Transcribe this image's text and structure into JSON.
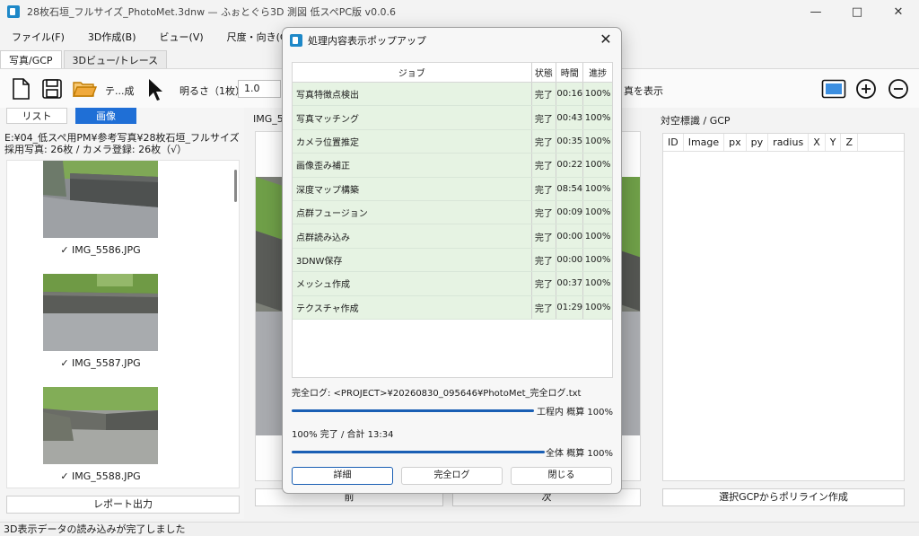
{
  "window": {
    "title": "28枚石垣_フルサイズ_PhotoMet.3dnw — ふぉとぐら3D 測図 低スペPC版 v0.0.6",
    "minimize": "—",
    "maximize": "□",
    "close": "✕"
  },
  "menu": [
    "ファイル(F)",
    "3D作成(B)",
    "ビュー(V)",
    "尺度・向き(C)"
  ],
  "tabs": [
    "写真/GCP",
    "3Dビュー/トレース"
  ],
  "toolbar": {
    "texture_label": "テ...成",
    "brightness_label": "明るさ（1枚）",
    "brightness_value": "1.0",
    "show_label": "真を表示"
  },
  "left": {
    "list_button": "リスト",
    "image_button": "画像",
    "path": "E:¥04_低スペ用PM¥参考写真¥28枚石垣_フルサイズ",
    "counts": "採用写真: 26枚 / カメラ登録: 26枚（√）",
    "thumbnails": [
      {
        "caption": "✓ IMG_5586.JPG"
      },
      {
        "caption": "✓ IMG_5587.JPG"
      },
      {
        "caption": "✓ IMG_5588.JPG"
      }
    ],
    "report_button": "レポート出力"
  },
  "center": {
    "image_label": "IMG_55",
    "prev_button": "前",
    "next_button": "次"
  },
  "right": {
    "title": "対空標識 / GCP",
    "columns": [
      "ID",
      "Image",
      "px",
      "py",
      "radius",
      "X",
      "Y",
      "Z"
    ],
    "polyline_button": "選択GCPからポリライン作成"
  },
  "status": "3D表示データの読み込みが完了しました",
  "dialog": {
    "title": "処理内容表示ポップアップ",
    "close": "✕",
    "headers": {
      "job": "ジョブ",
      "status": "状態",
      "time": "時間",
      "progress": "進捗"
    },
    "jobs": [
      {
        "name": "写真特徴点検出",
        "status": "完了",
        "time": "00:16",
        "progress": "100%"
      },
      {
        "name": "写真マッチング",
        "status": "完了",
        "time": "00:43",
        "progress": "100%"
      },
      {
        "name": "カメラ位置推定",
        "status": "完了",
        "time": "00:35",
        "progress": "100%"
      },
      {
        "name": "画像歪み補正",
        "status": "完了",
        "time": "00:22",
        "progress": "100%"
      },
      {
        "name": "深度マップ構築",
        "status": "完了",
        "time": "08:54",
        "progress": "100%"
      },
      {
        "name": "点群フュージョン",
        "status": "完了",
        "time": "00:09",
        "progress": "100%"
      },
      {
        "name": "点群読み込み",
        "status": "完了",
        "time": "00:00",
        "progress": "100%"
      },
      {
        "name": "3DNW保存",
        "status": "完了",
        "time": "00:00",
        "progress": "100%"
      },
      {
        "name": "メッシュ作成",
        "status": "完了",
        "time": "00:37",
        "progress": "100%"
      },
      {
        "name": "テクスチャ作成",
        "status": "完了",
        "time": "01:29",
        "progress": "100%"
      }
    ],
    "log": "完全ログ: <PROJECT>¥20260830_095646¥PhotoMet_完全ログ.txt",
    "step_progress_label": "工程内 概算 100%",
    "step_progress": 1.0,
    "total_line": "100% 完了 / 合計 13:34",
    "total_progress_label": "全体 概算 100%",
    "total_progress": 1.0,
    "buttons": {
      "detail": "詳細",
      "full_log": "完全ログ",
      "close": "閉じる"
    },
    "accent": "#1a5fb4",
    "row_color": "#e6f3e3"
  }
}
